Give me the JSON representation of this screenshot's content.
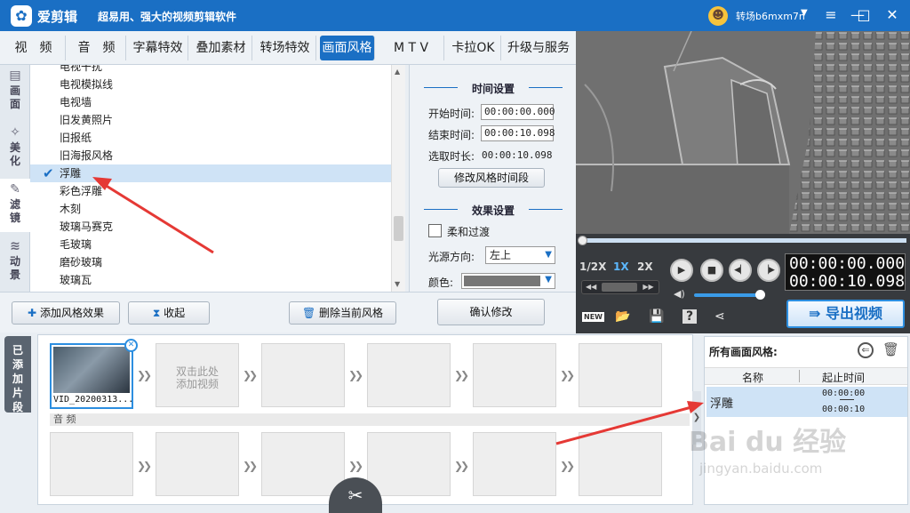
{
  "app": {
    "name": "爱剪辑",
    "slogan": "超易用、强大的视频剪辑软件",
    "logo_glyph": "✿",
    "user_name": "转场b6mxm7n",
    "user_avatar": "☻",
    "caret": "▼"
  },
  "window_buttons": {
    "menu": "≡",
    "minimize": "—",
    "maximize": "□",
    "close": "✕"
  },
  "tabs": [
    {
      "label": "视　频"
    },
    {
      "label": "音　频"
    },
    {
      "label": "字幕特效"
    },
    {
      "label": "叠加素材"
    },
    {
      "label": "转场特效"
    },
    {
      "label": "画面风格"
    },
    {
      "label": "M T V"
    },
    {
      "label": "卡拉OK"
    },
    {
      "label": "升级与服务"
    }
  ],
  "sidetabs": [
    {
      "label": "画面",
      "icon": "▤"
    },
    {
      "label": "美化",
      "icon": "✧"
    },
    {
      "label": "滤镜",
      "icon": "✎"
    },
    {
      "label": "动景",
      "icon": "≋"
    }
  ],
  "effects": [
    {
      "label": "电视干扰"
    },
    {
      "label": "电视模拟线"
    },
    {
      "label": "电视墙"
    },
    {
      "label": "旧发黄照片"
    },
    {
      "label": "旧报纸"
    },
    {
      "label": "旧海报风格"
    },
    {
      "label": "浮雕"
    },
    {
      "label": "彩色浮雕"
    },
    {
      "label": "木刻"
    },
    {
      "label": "玻璃马赛克"
    },
    {
      "label": "毛玻璃"
    },
    {
      "label": "磨砂玻璃"
    },
    {
      "label": "玻璃瓦"
    }
  ],
  "selected_check": "✔",
  "settings": {
    "time_title": "时间设置",
    "start_label": "开始时间:",
    "start_value": "00:00:00.000",
    "end_label": "结束时间:",
    "end_value": "00:00:10.098",
    "duration_label": "选取时长:",
    "duration_value": "00:00:10.098",
    "modify_time_btn": "修改风格时间段",
    "effect_title": "效果设置",
    "soft_transition": "柔和过渡",
    "light_dir_label": "光源方向:",
    "light_dir_value": "左上",
    "color_label": "颜色:",
    "confirm_btn": "确认修改"
  },
  "actions": {
    "add_effect": "添加风格效果",
    "collapse": "收起",
    "delete_current": "删除当前风格",
    "add_icon": "✚",
    "collapse_icon": "⧗",
    "delete_icon": "🗑"
  },
  "player": {
    "speeds": [
      "1/2X",
      "1X",
      "2X"
    ],
    "time_current": "00:00:00.000",
    "time_total": "00:00:10.098",
    "export": "导出视频",
    "play": "▶",
    "stop": "■",
    "prev": "◀▏",
    "next": "▕▶",
    "rew": "◀◀",
    "fwd": "▶▶",
    "volume_icon": "◀)",
    "tools": [
      "NEW",
      "📂",
      "💾",
      "?",
      "⋖"
    ],
    "volume_level": 0.8,
    "progress": 0.0
  },
  "timeline": {
    "added_tab": "已添加片段",
    "clip_name": "VID_20200313...",
    "add_hint": "双击此处\n添加视频",
    "audio_label": "音 频",
    "chevron": "❯❯",
    "scissor": "✂",
    "expander": "❯"
  },
  "right_panel": {
    "title": "所有画面风格:",
    "col_name": "名称",
    "col_time": "起止时间",
    "row_name": "浮雕",
    "row_start": "00:00:00",
    "row_end": "00:00:10",
    "back_icon": "⊖",
    "trash_icon": "🗑"
  },
  "watermark": {
    "line1": "Bai du 经验",
    "line2": "jingyan.baidu.com"
  },
  "colors": {
    "accent": "#1a6fc4",
    "annotation": "#e53935",
    "selected": "#cfe3f6"
  }
}
